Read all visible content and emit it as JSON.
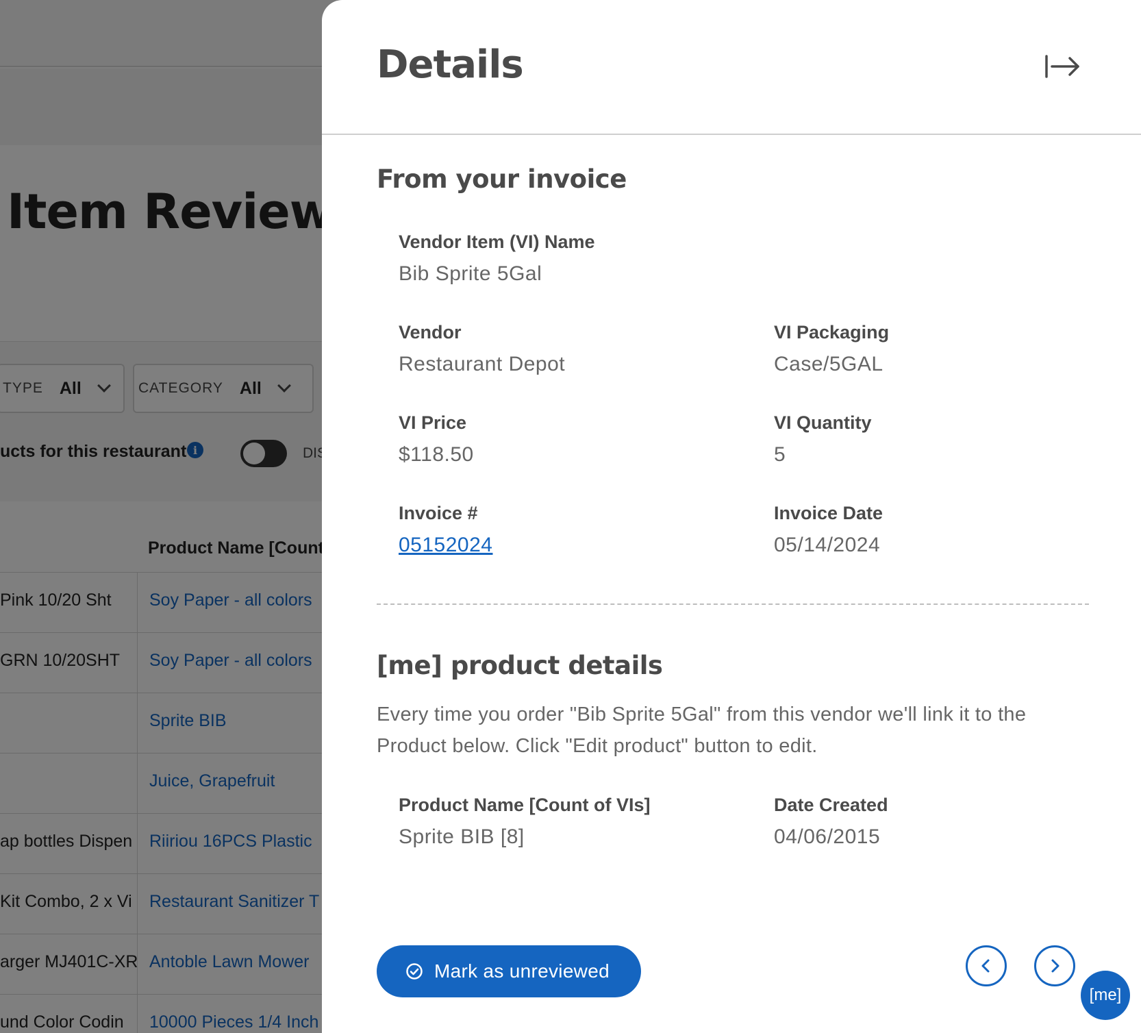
{
  "background": {
    "page_title": "Item Review",
    "filters": [
      {
        "label": "TYPE",
        "value": "All"
      },
      {
        "label": "CATEGORY",
        "value": "All"
      }
    ],
    "toggle_label": "ucts for this restaurant",
    "toggle_text": "DIS",
    "table": {
      "header": "Product Name [Count",
      "rows": [
        {
          "vi": "Pink 10/20 Sht",
          "product": "Soy Paper - all colors"
        },
        {
          "vi": "GRN 10/20SHT",
          "product": "Soy Paper - all colors"
        },
        {
          "vi": "",
          "product": "Sprite BIB"
        },
        {
          "vi": "",
          "product": "Juice, Grapefruit"
        },
        {
          "vi": "ap bottles Dispen",
          "product": "Riiriou 16PCS Plastic"
        },
        {
          "vi": "Kit Combo, 2 x Vi",
          "product": "Restaurant Sanitizer T"
        },
        {
          "vi": "arger MJ401C-XR",
          "product": "Antoble Lawn Mower"
        },
        {
          "vi": "und Color Codin",
          "product": "10000 Pieces 1/4 Inch"
        }
      ]
    }
  },
  "drawer": {
    "title": "Details",
    "collapse_icon": "arrow-collapse-right-icon",
    "invoice_section": {
      "title": "From your invoice",
      "vi_name_label": "Vendor Item (VI) Name",
      "vi_name": "Bib Sprite 5Gal",
      "vendor_label": "Vendor",
      "vendor": "Restaurant Depot",
      "packaging_label": "VI Packaging",
      "packaging": "Case/5GAL",
      "price_label": "VI Price",
      "price": "$118.50",
      "quantity_label": "VI Quantity",
      "quantity": "5",
      "invoice_no_label": "Invoice #",
      "invoice_no": "05152024",
      "invoice_date_label": "Invoice Date",
      "invoice_date": "05/14/2024"
    },
    "product_section": {
      "title": "[me] product details",
      "description": "Every time you order \"Bib Sprite 5Gal\" from this vendor we'll link it to the Product below. Click \"Edit product\" button to edit.",
      "product_name_label": "Product Name [Count of VIs]",
      "product_name": "Sprite BIB [8]",
      "date_created_label": "Date Created",
      "date_created": "04/06/2015"
    },
    "footer": {
      "mark_button": "Mark as unreviewed",
      "prev_icon": "chevron-left-icon",
      "next_icon": "chevron-right-icon"
    },
    "me_badge": "[me]"
  },
  "colors": {
    "accent": "#1565c0",
    "overlay": "rgba(0,0,0,0.5)"
  }
}
